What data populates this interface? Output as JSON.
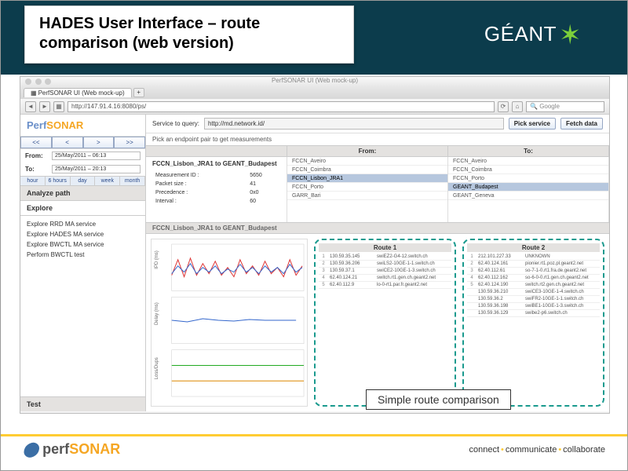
{
  "slide": {
    "title": "HADES User Interface – route comparison (web version)",
    "brand": "GÉANT",
    "callout": "Simple route comparison"
  },
  "browser": {
    "window_title": "PerfSONAR UI (Web mock-up)",
    "tab_label": "PerfSONAR UI (Web mock-up)",
    "url": "http://147.91.4.16:8080/ps/",
    "search_placeholder": "Google"
  },
  "app_logo": {
    "perf": "Perf",
    "sonar": "SONAR"
  },
  "time_nav": [
    "<<",
    "<",
    ">",
    ">>"
  ],
  "from_label": "From:",
  "to_label": "To:",
  "from_date": "25/May/2011 – 06:13",
  "to_date": "25/May/2011 – 20:13",
  "range_tabs": [
    "hour",
    "6 hours",
    "day",
    "week",
    "month"
  ],
  "sections": {
    "analyze": "Analyze path",
    "explore": "Explore",
    "test": "Test"
  },
  "explore_links": [
    "Explore RRD MA service",
    "Explore HADES MA service",
    "Explore BWCTL MA service",
    "Perform BWCTL test"
  ],
  "service": {
    "label": "Service to query:",
    "value": "http://md.network.id/",
    "pick_btn": "Pick service",
    "fetch_btn": "Fetch data"
  },
  "endpoint_prompt": "Pick an endpoint pair to get measurements",
  "fromto_headers": {
    "from": "From:",
    "to": "To:"
  },
  "pair": {
    "title": "FCCN_Lisbon_JRA1 to GEANT_Budapest",
    "rows": [
      [
        "Measurement ID :",
        "5650"
      ],
      [
        "Packet size :",
        "41"
      ],
      [
        "Precedence :",
        "0x0"
      ],
      [
        "Interval :",
        "60"
      ]
    ]
  },
  "from_list": [
    {
      "label": "FCCN_Aveiro",
      "sel": false
    },
    {
      "label": "FCCN_Coimbra",
      "sel": false
    },
    {
      "label": "FCCN_Lisbon_JRA1",
      "sel": true
    },
    {
      "label": "FCCN_Porto",
      "sel": false
    },
    {
      "label": "GARR_Bari",
      "sel": false
    }
  ],
  "to_list": [
    {
      "label": "FCCN_Aveiro",
      "sel": false
    },
    {
      "label": "FCCN_Coimbra",
      "sel": false
    },
    {
      "label": "FCCN_Porto",
      "sel": false
    },
    {
      "label": "GEANT_Budapest",
      "sel": true
    },
    {
      "label": "GEANT_Geneva",
      "sel": false
    }
  ],
  "route_section_title": "FCCN_Lisbon_JRA1 to GEANT_Budapest",
  "charts": {
    "ylabels": [
      "IPD (ms)",
      "Delay (ms)",
      "Loss/Dups"
    ]
  },
  "route1": {
    "title": "Route 1",
    "hops": [
      [
        "1",
        "130.59.35.145",
        "swiEZ2-G4-12.switch.ch"
      ],
      [
        "2",
        "130.59.36.206",
        "swiLS2-10GE-1-1.switch.ch"
      ],
      [
        "3",
        "130.59.37.1",
        "swiCE2-10GE-1-3.switch.ch"
      ],
      [
        "4",
        "62.40.124.21",
        "switch.rt1.gen.ch.geant2.net"
      ],
      [
        "5",
        "62.40.112.9",
        "lo-0-rt1.par.fr.geant2.net"
      ]
    ]
  },
  "route2": {
    "title": "Route 2",
    "hops": [
      [
        "1",
        "212.101.227.33",
        "UNKNOWN"
      ],
      [
        "2",
        "62.40.124.161",
        "pionier.rt1.poz.pl.geant2.net"
      ],
      [
        "3",
        "62.40.112.61",
        "so-7-1-0.rt1.fra.de.geant2.net"
      ],
      [
        "4",
        "62.40.112.162",
        "so-6-0-0.rt1.gen.ch.geant2.net"
      ],
      [
        "5",
        "62.40.124.190",
        "switch.rt2.gen.ch.geant2.net"
      ],
      [
        "",
        "130.59.36.210",
        "swiCE3-10GE-1-4.switch.ch"
      ],
      [
        "",
        "130.59.36.2",
        "swiFR2-10GE-1-1.switch.ch"
      ],
      [
        "",
        "130.59.36.198",
        "swiBE1-10GE-1-3.switch.ch"
      ],
      [
        "",
        "130.59.36.129",
        "swibe2-p6.switch.ch"
      ]
    ]
  },
  "footer": {
    "logo_perf": "perf",
    "logo_sonar": "SONAR",
    "tagline": [
      "connect",
      "communicate",
      "collaborate"
    ]
  }
}
